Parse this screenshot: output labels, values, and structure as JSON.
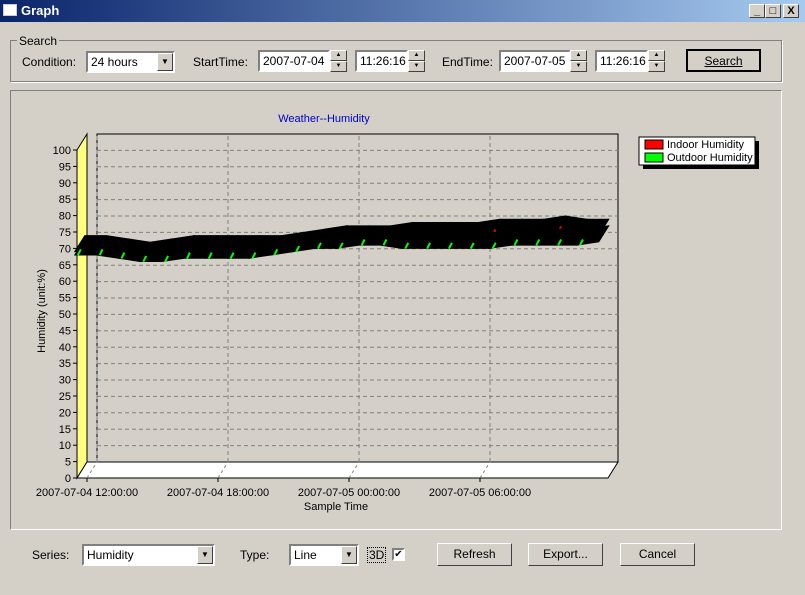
{
  "window": {
    "title": "Graph",
    "minimize": "_",
    "maximize": "□",
    "close": "X"
  },
  "search": {
    "group_label": "Search",
    "condition_label": "Condition:",
    "condition_value": "24 hours",
    "start_label": "StartTime:",
    "start_date": "2007-07-04",
    "start_time": "11:26:16",
    "end_label": "EndTime:",
    "end_date": "2007-07-05",
    "end_time": "11:26:16",
    "search_button": "Search"
  },
  "bottom": {
    "series_label": "Series:",
    "series_value": "Humidity",
    "type_label": "Type:",
    "type_value": "Line",
    "threed_label": "3D",
    "threed_checked": true,
    "refresh": "Refresh",
    "export": "Export...",
    "cancel": "Cancel"
  },
  "chart_data": {
    "type": "line",
    "title": "Weather--Humidity",
    "xlabel": "Sample Time",
    "ylabel": "Humidity (unit:%)",
    "ylim": [
      0,
      100
    ],
    "yticks": [
      0,
      5,
      10,
      15,
      20,
      25,
      30,
      35,
      40,
      45,
      50,
      55,
      60,
      65,
      70,
      75,
      80,
      85,
      90,
      95,
      100
    ],
    "xticks": [
      "2007-07-04 12:00:00",
      "2007-07-04 18:00:00",
      "2007-07-05 00:00:00",
      "2007-07-05 06:00:00"
    ],
    "x_hours_from_first_tick": [
      -0.56,
      0.44,
      1.44,
      2.44,
      3.44,
      4.44,
      5.44,
      6.44,
      7.44,
      8.44,
      9.44,
      10.44,
      11.44,
      12.44,
      13.44,
      14.44,
      15.44,
      16.44,
      17.44,
      18.44,
      19.44,
      20.44,
      21.44,
      22.44,
      23.44
    ],
    "grid": true,
    "legend": "top-right",
    "three_d": true,
    "series": [
      {
        "name": "Indoor Humidity",
        "color": "#ff0000",
        "values": [
          69,
          69,
          68,
          67,
          68,
          69,
          69,
          69,
          69,
          69,
          70,
          71,
          72,
          72,
          72,
          73,
          73,
          73,
          73,
          74,
          74,
          74,
          75,
          74,
          74
        ]
      },
      {
        "name": "Outdoor Humidity",
        "color": "#00ff00",
        "values": [
          68,
          68,
          67,
          66,
          66,
          67,
          67,
          67,
          67,
          68,
          69,
          70,
          70,
          71,
          71,
          70,
          70,
          70,
          70,
          70,
          71,
          71,
          71,
          71,
          72
        ]
      }
    ]
  }
}
